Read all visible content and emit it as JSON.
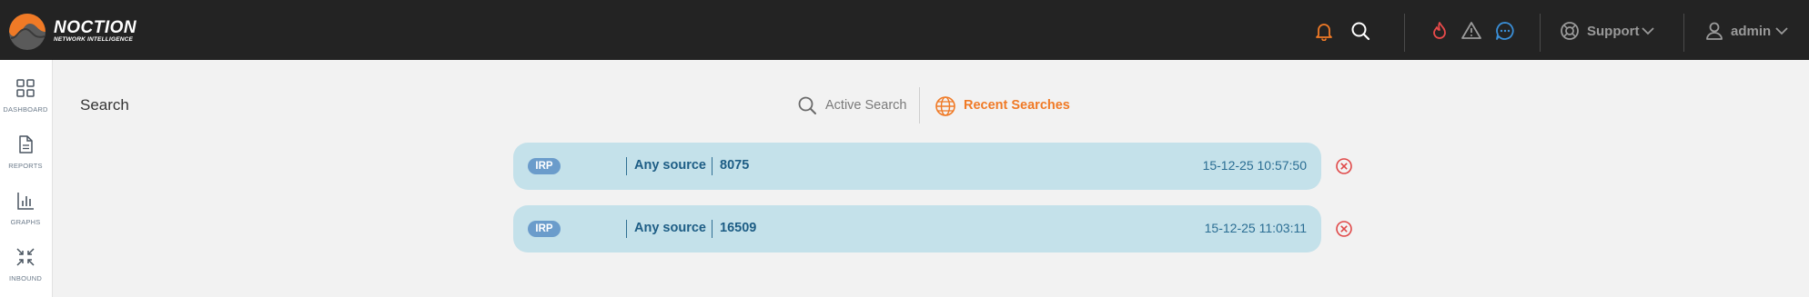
{
  "brand": {
    "name": "NOCTION",
    "tagline": "NETWORK INTELLIGENCE",
    "accent": "#f07a26"
  },
  "header": {
    "support_label": "Support",
    "user_label": "admin",
    "icons": [
      "bell-icon",
      "search-icon",
      "flame-icon",
      "warning-icon",
      "chat-icon",
      "lifebuoy-icon",
      "user-icon"
    ]
  },
  "sidebar": {
    "items": [
      {
        "label": "DASHBOARD",
        "icon": "grid-icon"
      },
      {
        "label": "REPORTS",
        "icon": "document-icon"
      },
      {
        "label": "GRAPHS",
        "icon": "bar-chart-icon"
      },
      {
        "label": "INBOUND",
        "icon": "compress-icon"
      }
    ]
  },
  "page": {
    "title": "Search",
    "tabs": {
      "active_search": "Active Search",
      "recent_searches": "Recent Searches"
    }
  },
  "searches": [
    {
      "type": "IRP",
      "source": "Any source",
      "value": "8075",
      "timestamp": "15-12-25 10:57:50"
    },
    {
      "type": "IRP",
      "source": "Any source",
      "value": "16509",
      "timestamp": "15-12-25 11:03:11"
    }
  ]
}
